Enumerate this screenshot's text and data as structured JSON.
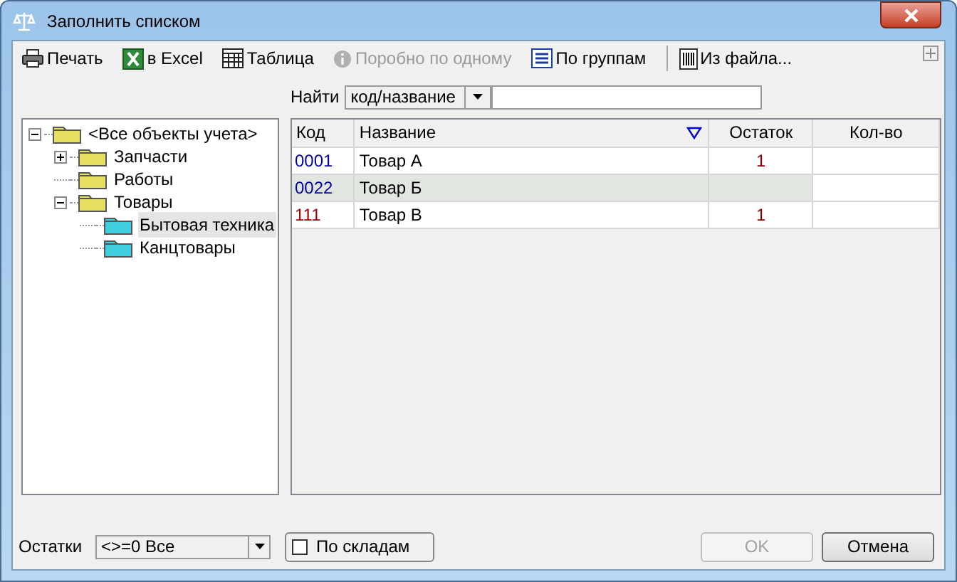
{
  "window": {
    "title": "Заполнить списком"
  },
  "toolbar": [
    {
      "kind": "printer",
      "label": "Печать",
      "disabled": false
    },
    {
      "kind": "excel",
      "label": "в Excel",
      "disabled": false
    },
    {
      "kind": "table",
      "label": "Таблица",
      "disabled": false
    },
    {
      "kind": "info",
      "label": "Поробно по одному",
      "disabled": true
    },
    {
      "kind": "list",
      "label": "По группам",
      "disabled": false
    },
    {
      "kind": "barcode",
      "label": "Из файла...",
      "disabled": false
    }
  ],
  "search": {
    "label": "Найти",
    "mode": "код/название"
  },
  "tree": [
    {
      "label": "<Все объекты учета>",
      "color": "#e8e060",
      "selected": false,
      "expanded": true,
      "children": [
        {
          "label": "Запчасти",
          "color": "#e8e060",
          "selected": false,
          "expanded": false
        },
        {
          "label": "Работы",
          "color": "#e8e060",
          "selected": false
        },
        {
          "label": "Товары",
          "color": "#e8e060",
          "selected": false,
          "expanded": true,
          "children": [
            {
              "label": "Бытовая техника",
              "color": "#40d0e0",
              "selected": true
            },
            {
              "label": "Канцтовары",
              "color": "#40d0e0",
              "selected": false
            }
          ]
        }
      ]
    }
  ],
  "table": {
    "columns": [
      "Код",
      "Название",
      "Остаток",
      "Кол-во"
    ],
    "rows": [
      {
        "code": "0001",
        "name": "Товар А",
        "stock": "1",
        "color": "#0000a0",
        "selected": false
      },
      {
        "code": "0022",
        "name": "Товар Б",
        "color": "#0000a0",
        "selected": true
      },
      {
        "code": "111",
        "name": "Товар В",
        "stock": "1",
        "color": "#a00000",
        "selected": false
      }
    ]
  },
  "footer": {
    "stock_label": "Остатки",
    "stock_filter": "<>=0 Все",
    "by_warehouse": {
      "label": "По складам",
      "checked": false
    },
    "buttons": [
      {
        "label": "OK",
        "disabled": true
      },
      {
        "label": "Отмена",
        "disabled": false
      }
    ]
  }
}
